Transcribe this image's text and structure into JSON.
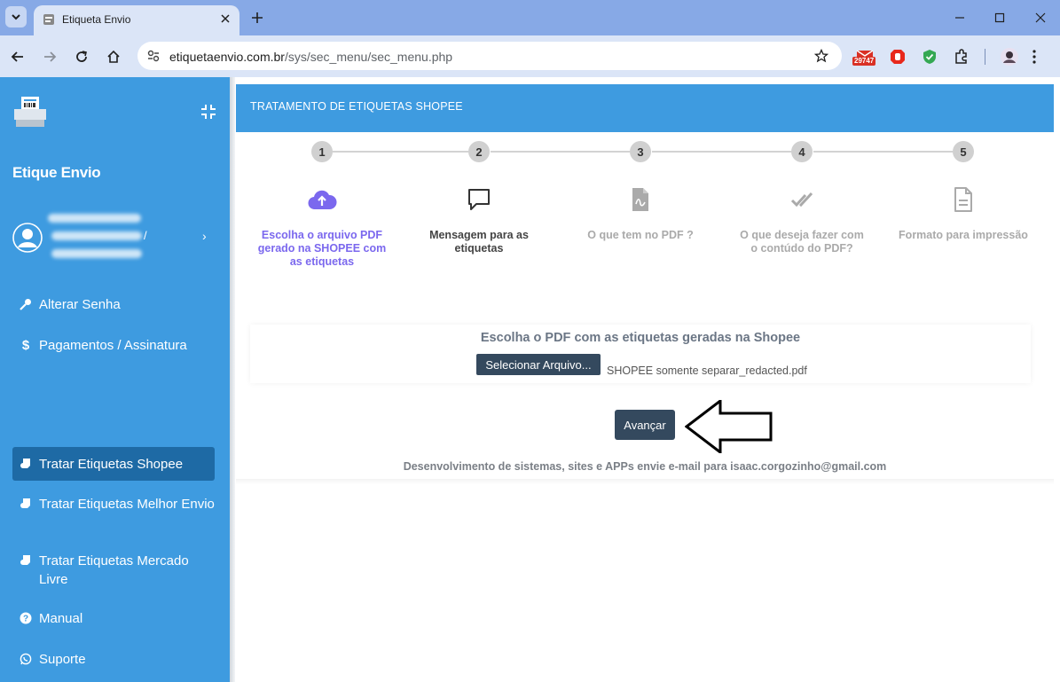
{
  "browser": {
    "tab_title": "Etiqueta Envio",
    "url_host": "etiquetaenvio.com.br",
    "url_path": "/sys/sec_menu/sec_menu.php",
    "ext_badge": "29747"
  },
  "sidebar": {
    "brand": "Etique Envio",
    "user_separator": "/",
    "items": [
      {
        "label": "Alterar Senha",
        "icon": "key-icon"
      },
      {
        "label": "Pagamentos / Assinatura",
        "icon": "dollar-icon"
      },
      {
        "label": "Tratar Etiquetas Shopee",
        "icon": "label-icon",
        "active": true
      },
      {
        "label": "Tratar Etiquetas Melhor Envio",
        "icon": "label-icon"
      },
      {
        "label": "Tratar Etiquetas Mercado Livre",
        "icon": "label-icon"
      },
      {
        "label": "Manual",
        "icon": "question-icon"
      },
      {
        "label": "Suporte",
        "icon": "whatsapp-icon"
      }
    ]
  },
  "panel": {
    "title": "TRATAMENTO DE ETIQUETAS SHOPEE"
  },
  "steps": [
    {
      "num": "1",
      "label": "Escolha o arquivo PDF gerado na SHOPEE com as etiquetas",
      "icon": "cloud-upload-icon",
      "state": "active"
    },
    {
      "num": "2",
      "label": "Mensagem para as etiquetas",
      "icon": "message-icon",
      "state": "dark"
    },
    {
      "num": "3",
      "label": "O que tem no PDF ?",
      "icon": "pdf-file-icon",
      "state": "muted"
    },
    {
      "num": "4",
      "label": "O que deseja fazer com o contúdo do PDF?",
      "icon": "double-check-icon",
      "state": "muted"
    },
    {
      "num": "5",
      "label": "Formato para impressão",
      "icon": "document-icon",
      "state": "muted"
    }
  ],
  "upload": {
    "title": "Escolha o PDF com as etiquetas geradas na Shopee",
    "button": "Selecionar Arquivo...",
    "file_name": "SHOPEE somente separar_redacted.pdf"
  },
  "advance_button": "Avançar",
  "footer": "Desenvolvimento de sistemas, sites e APPs envie e-mail para isaac.corgozinho@gmail.com",
  "colors": {
    "sidebar": "#3e9be0",
    "active_item": "#1e6aa5",
    "step_active": "#7b68ee",
    "button": "#34495e"
  }
}
